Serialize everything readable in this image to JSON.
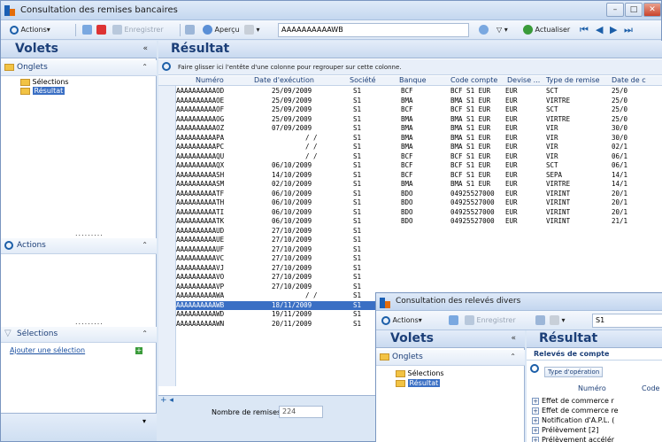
{
  "window": {
    "title": "Consultation des remises bancaires",
    "controls": [
      "–",
      "□",
      "✕"
    ]
  },
  "toolbar": {
    "actions": "Actions▾",
    "enregistrer": "Enregistrer",
    "apercu": "Aperçu",
    "search_value": "AAAAAAAAAAWB",
    "actualiser": "Actualiser"
  },
  "left": {
    "volets": "Volets",
    "onglets": "Onglets",
    "tree": [
      "Sélections",
      "Résultat"
    ],
    "actions": "Actions",
    "selections": "Sélections",
    "ajouter": "Ajouter une sélection",
    "dots": "........."
  },
  "main": {
    "title": "Résultat",
    "group_hint": "Faire glisser ici l'entête d'une colonne pour regrouper sur cette colonne.",
    "columns": [
      "Numéro",
      "Date d'exécution",
      "Société",
      "Banque",
      "Code compte",
      "Devise ...",
      "Type de remise",
      "Date de c"
    ],
    "rows": [
      [
        "AAAAAAAAAAOD",
        "25/09/2009",
        "S1",
        "BCF",
        "BCF S1 EUR",
        "EUR",
        "SCT",
        "25/0"
      ],
      [
        "AAAAAAAAAAOE",
        "25/09/2009",
        "S1",
        "BMA",
        "BMA S1 EUR",
        "EUR",
        "VIRTRE",
        "25/0"
      ],
      [
        "AAAAAAAAAAOF",
        "25/09/2009",
        "S1",
        "BCF",
        "BCF S1 EUR",
        "EUR",
        "SCT",
        "25/0"
      ],
      [
        "AAAAAAAAAAOG",
        "25/09/2009",
        "S1",
        "BMA",
        "BMA S1 EUR",
        "EUR",
        "VIRTRE",
        "25/0"
      ],
      [
        "AAAAAAAAAAOZ",
        "07/09/2009",
        "S1",
        "BMA",
        "BMA S1 EUR",
        "EUR",
        "VIR",
        "30/0"
      ],
      [
        "AAAAAAAAAAPA",
        "/ /",
        "S1",
        "BMA",
        "BMA S1 EUR",
        "EUR",
        "VIR",
        "30/0"
      ],
      [
        "AAAAAAAAAAPC",
        "/ /",
        "S1",
        "BMA",
        "BMA S1 EUR",
        "EUR",
        "VIR",
        "02/1"
      ],
      [
        "AAAAAAAAAAQU",
        "/ /",
        "S1",
        "BCF",
        "BCF S1 EUR",
        "EUR",
        "VIR",
        "06/1"
      ],
      [
        "AAAAAAAAAAQX",
        "06/10/2009",
        "S1",
        "BCF",
        "BCF S1 EUR",
        "EUR",
        "SCT",
        "06/1"
      ],
      [
        "AAAAAAAAAASH",
        "14/10/2009",
        "S1",
        "BCF",
        "BCF S1 EUR",
        "EUR",
        "SEPA",
        "14/1"
      ],
      [
        "AAAAAAAAAASM",
        "02/10/2009",
        "S1",
        "BMA",
        "BMA S1 EUR",
        "EUR",
        "VIRTRE",
        "14/1"
      ],
      [
        "AAAAAAAAAATF",
        "06/10/2009",
        "S1",
        "BDO",
        "04925527000",
        "EUR",
        "VIRINT",
        "20/1"
      ],
      [
        "AAAAAAAAAATH",
        "06/10/2009",
        "S1",
        "BDO",
        "04925527000",
        "EUR",
        "VIRINT",
        "20/1"
      ],
      [
        "AAAAAAAAAATI",
        "06/10/2009",
        "S1",
        "BDO",
        "04925527000",
        "EUR",
        "VIRINT",
        "20/1"
      ],
      [
        "AAAAAAAAAATK",
        "06/10/2009",
        "S1",
        "BDO",
        "04925527000",
        "EUR",
        "VIRINT",
        "21/1"
      ],
      [
        "AAAAAAAAAAUD",
        "27/10/2009",
        "S1",
        "",
        "",
        "",
        "",
        ""
      ],
      [
        "AAAAAAAAAAUE",
        "27/10/2009",
        "S1",
        "",
        "",
        "",
        "",
        ""
      ],
      [
        "AAAAAAAAAAUF",
        "27/10/2009",
        "S1",
        "",
        "",
        "",
        "",
        ""
      ],
      [
        "AAAAAAAAAAVC",
        "27/10/2009",
        "S1",
        "",
        "",
        "",
        "",
        ""
      ],
      [
        "AAAAAAAAAAVJ",
        "27/10/2009",
        "S1",
        "",
        "",
        "",
        "",
        ""
      ],
      [
        "AAAAAAAAAAVO",
        "27/10/2009",
        "S1",
        "",
        "",
        "",
        "",
        ""
      ],
      [
        "AAAAAAAAAAVP",
        "27/10/2009",
        "S1",
        "",
        "",
        "",
        "",
        ""
      ],
      [
        "AAAAAAAAAAWA",
        "/ /",
        "S1",
        "",
        "",
        "",
        "",
        ""
      ],
      [
        "AAAAAAAAAAWB",
        "18/11/2009",
        "S1",
        "",
        "",
        "",
        "",
        ""
      ],
      [
        "AAAAAAAAAAWD",
        "19/11/2009",
        "S1",
        "",
        "",
        "",
        "",
        ""
      ],
      [
        "AAAAAAAAAAWN",
        "20/11/2009",
        "S1",
        "",
        "",
        "",
        "",
        ""
      ]
    ],
    "selected_row": 23,
    "footer_label": "Nombre de remises :",
    "footer_value": "224"
  },
  "win2": {
    "title": "Consultation des relevés divers",
    "actions": "Actions▾",
    "enregistrer": "Enregistrer",
    "search_value": "S1",
    "volets": "Volets",
    "onglets": "Onglets",
    "tree": [
      "Sélections",
      "Résultat"
    ],
    "resultat": "Résultat",
    "sub": "Relevés de compte",
    "type_op_btn": "Type d'opération",
    "col_numero": "Numéro",
    "col_code": "Code",
    "items": [
      "Effet de commerce r",
      "Effet de commerce re",
      "Notification d'A.P.L. (",
      "Prélèvement [2]",
      "Prélèvement accélér",
      "Prélèvement rectifié"
    ]
  }
}
